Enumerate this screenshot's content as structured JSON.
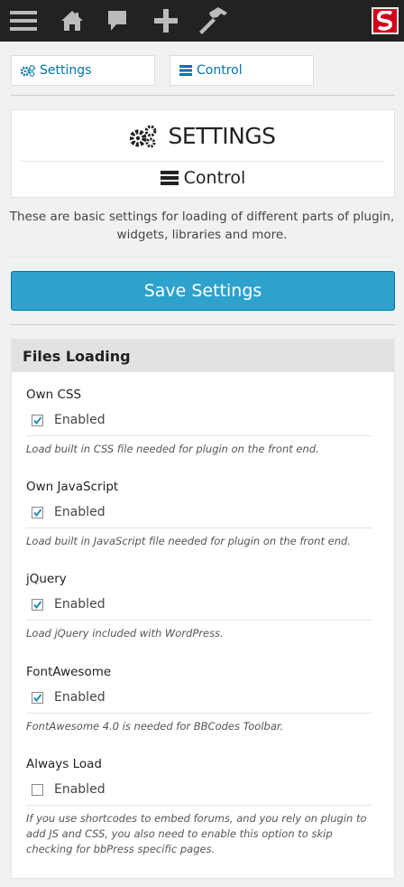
{
  "adminbar": {
    "icons": [
      "menu-icon",
      "home-icon",
      "comment-icon",
      "plus-icon",
      "hammer-icon"
    ],
    "avatar_letter": "S"
  },
  "tabs": [
    {
      "label": "Settings",
      "icon": "gears-icon"
    },
    {
      "label": "Control",
      "icon": "server-icon"
    }
  ],
  "header": {
    "title": "SETTINGS",
    "subtitle": "Control"
  },
  "intro": "These are basic settings for loading of different parts of plugin, widgets, libraries and more.",
  "save_label": "Save Settings",
  "panel": {
    "title": "Files Loading",
    "options": [
      {
        "label": "Own CSS",
        "checkbox_label": "Enabled",
        "checked": true,
        "description": "Load built in CSS file needed for plugin on the front end."
      },
      {
        "label": "Own JavaScript",
        "checkbox_label": "Enabled",
        "checked": true,
        "description": "Load built in JavaScript file needed for plugin on the front end."
      },
      {
        "label": "jQuery",
        "checkbox_label": "Enabled",
        "checked": true,
        "description": "Load jQuery included with WordPress."
      },
      {
        "label": "FontAwesome",
        "checkbox_label": "Enabled",
        "checked": true,
        "description": "FontAwesome 4.0 is needed for BBCodes Toolbar."
      },
      {
        "label": "Always Load",
        "checkbox_label": "Enabled",
        "checked": false,
        "description": "If you use shortcodes to embed forums, and you rely on plugin to add JS and CSS, you also need to enable this option to skip checking for bbPress specific pages."
      }
    ]
  },
  "colors": {
    "adminbar": "#222222",
    "accent": "#2ea2cc",
    "link": "#0073aa",
    "avatar": "#d0021b"
  }
}
